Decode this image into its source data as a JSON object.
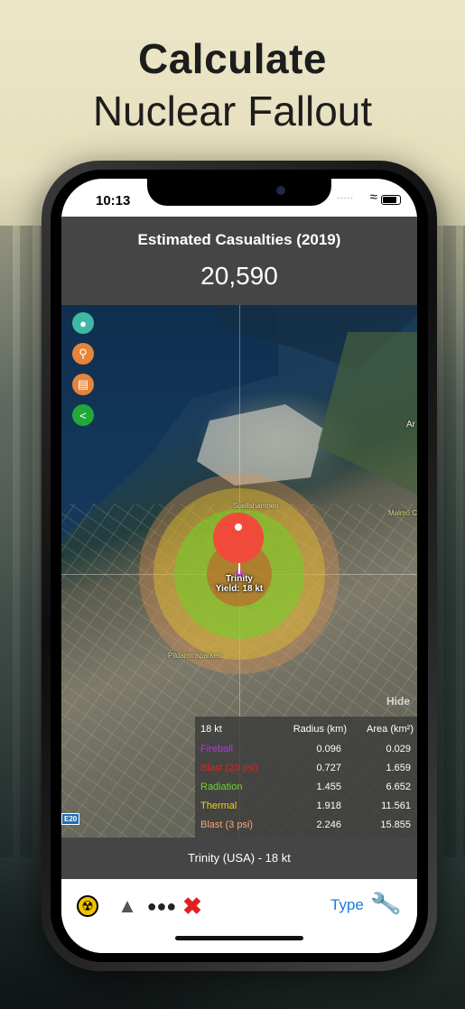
{
  "promo": {
    "line1": "Calculate",
    "line2": "Nuclear Fallout"
  },
  "statusbar": {
    "time": "10:13",
    "signal": ".....",
    "wifi_icon": "wifi-icon",
    "battery_icon": "battery-icon"
  },
  "header": {
    "title": "Estimated Casualties (2019)",
    "count": "20,590"
  },
  "map": {
    "side_buttons": [
      "locate-icon",
      "search-icon",
      "book-icon",
      "share-icon"
    ],
    "pin_label_line1": "Trinity",
    "pin_label_line2": "Yield: 18 kt",
    "places": [
      "Suelishamnen",
      "Pildammsparken",
      "Ar",
      "Malmö C"
    ],
    "hide_label": "Hide",
    "road_sign": "E20"
  },
  "legend": {
    "header": [
      "18 kt",
      "Radius (km)",
      "Area (km²)"
    ],
    "rows": [
      {
        "name": "Fireball",
        "radius": "0.096",
        "area": "0.029",
        "color": "#b13ad6"
      },
      {
        "name": "Blast (20 psi)",
        "radius": "0.727",
        "area": "1.659",
        "color": "#e1231d"
      },
      {
        "name": "Radiation",
        "radius": "1.455",
        "area": "6.652",
        "color": "#6fd42b"
      },
      {
        "name": "Thermal",
        "radius": "1.918",
        "area": "11.561",
        "color": "#f0d21a"
      },
      {
        "name": "Blast (3 psi)",
        "radius": "2.246",
        "area": "15.855",
        "color": "#f0a874"
      }
    ]
  },
  "footer": {
    "weapon": "Trinity (USA) - 18 kt"
  },
  "tabbar": {
    "icons": [
      "radiation-icon",
      "map-pin-icon",
      "people-icon",
      "close-icon"
    ],
    "type_label": "Type",
    "wrench_icon": "wrench-icon"
  },
  "colors": {
    "header_bg": "#454545",
    "pin": "#f04b3a",
    "accent": "#1d7be0"
  }
}
